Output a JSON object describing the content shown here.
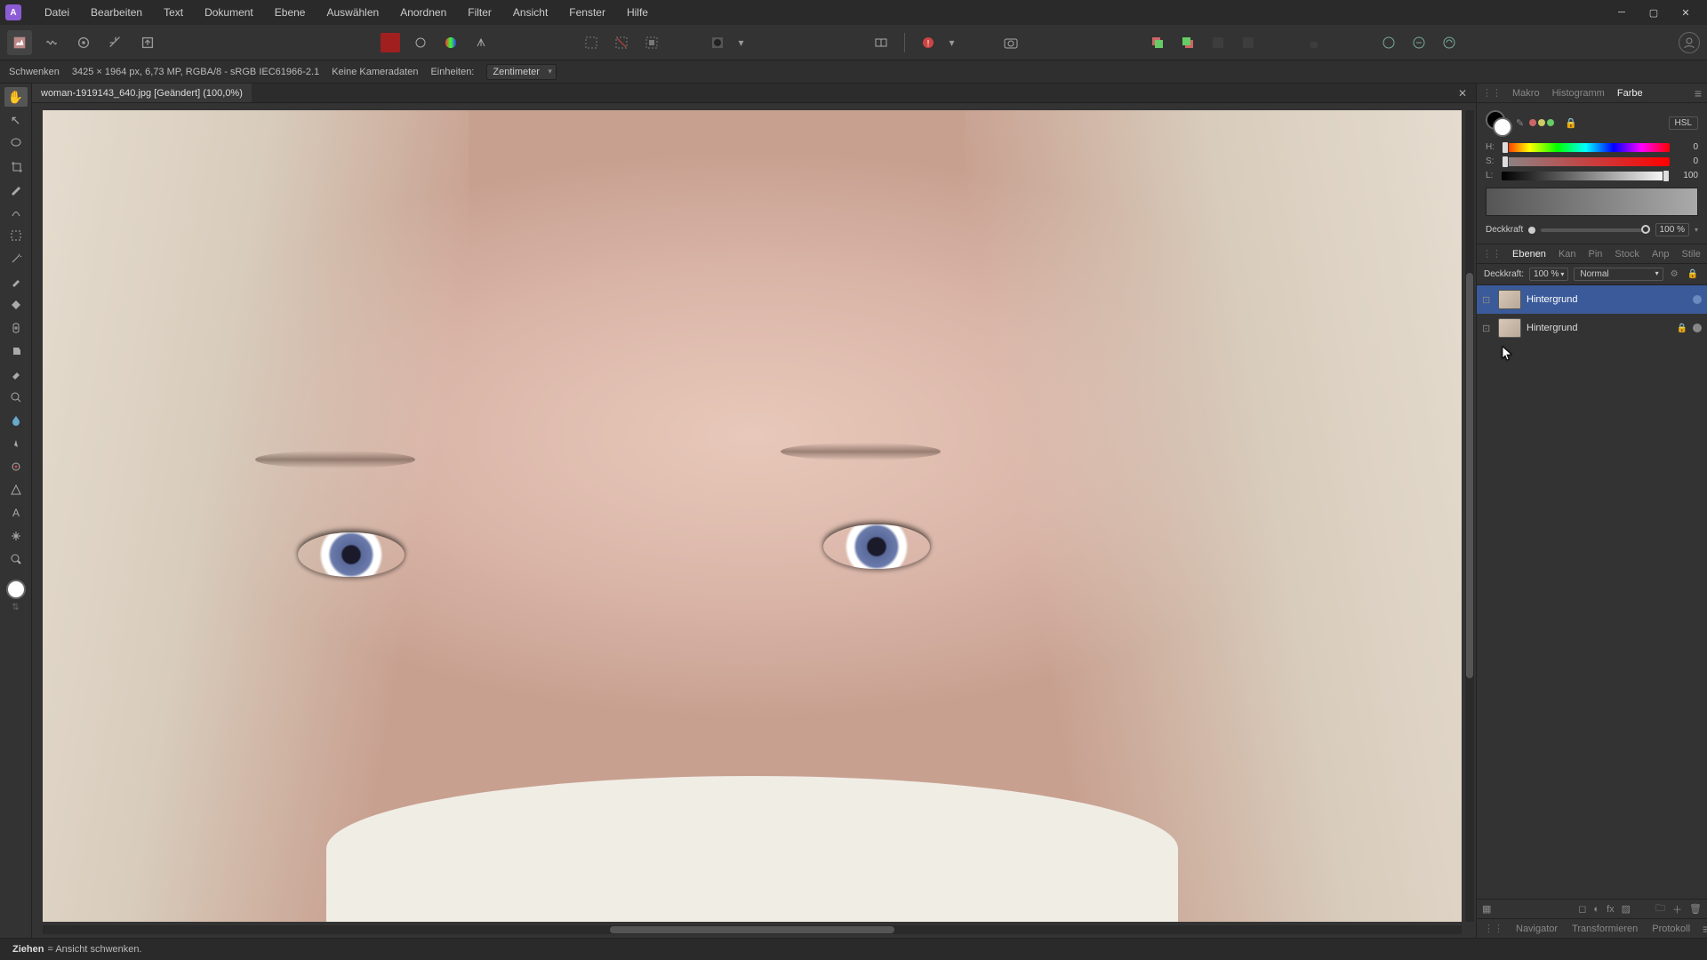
{
  "menu": {
    "items": [
      "Datei",
      "Bearbeiten",
      "Text",
      "Dokument",
      "Ebene",
      "Auswählen",
      "Anordnen",
      "Filter",
      "Ansicht",
      "Fenster",
      "Hilfe"
    ]
  },
  "context": {
    "tool": "Schwenken",
    "dims": "3425 × 1964 px, 6,73 MP, RGBA/8 - sRGB IEC61966-2.1",
    "camera": "Keine Kameradaten",
    "units_label": "Einheiten:",
    "units_value": "Zentimeter"
  },
  "document": {
    "tab_title": "woman-1919143_640.jpg [Geändert] (100,0%)"
  },
  "color_panel": {
    "tabs": [
      "Makro",
      "Histogramm",
      "Farbe"
    ],
    "active_tab": 2,
    "mode": "HSL",
    "sliders": {
      "H": 0,
      "S": 0,
      "L": 100
    },
    "opacity_label": "Deckkraft",
    "opacity_value": "100 %"
  },
  "layers_panel": {
    "tabs": [
      "Ebenen",
      "Kan",
      "Pin",
      "Stock",
      "Anp",
      "Stile"
    ],
    "active_tab": 0,
    "opacity_label": "Deckkraft:",
    "opacity_value": "100 %",
    "blend_mode": "Normal",
    "layers": [
      {
        "name": "Hintergrund",
        "selected": true,
        "locked": false,
        "visible": true
      },
      {
        "name": "Hintergrund",
        "selected": false,
        "locked": true,
        "visible": true
      }
    ]
  },
  "bottom_panel": {
    "tabs": [
      "Navigator",
      "Transformieren",
      "Protokoll"
    ]
  },
  "status": {
    "bold": "Ziehen",
    "text": "= Ansicht schwenken."
  }
}
